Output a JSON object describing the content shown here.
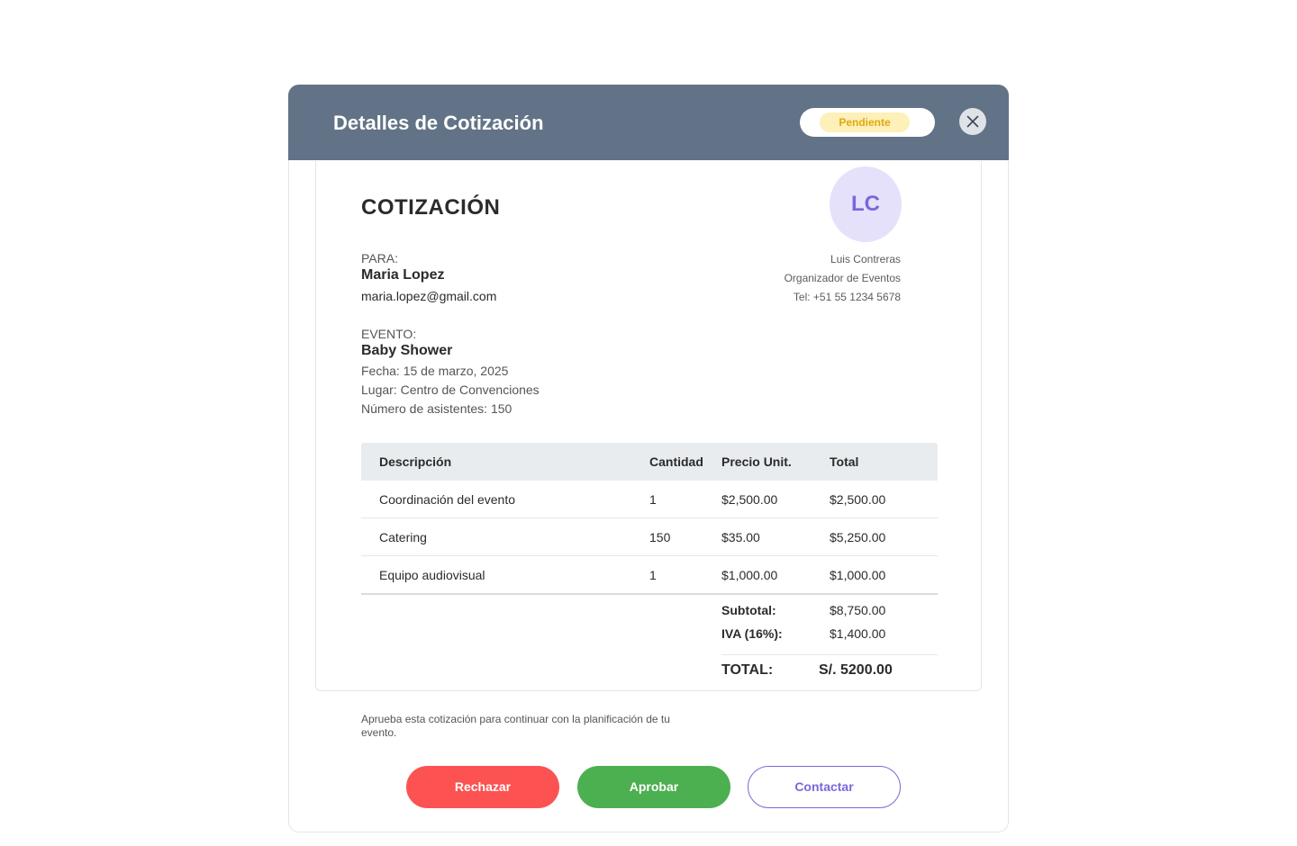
{
  "modal": {
    "title": "Detalles de Cotización",
    "status": "Pendiente",
    "close_icon": "close-icon"
  },
  "document": {
    "title": "COTIZACIÓN",
    "avatar_initials": "LC",
    "organizer": {
      "name": "Luis Contreras",
      "role": "Organizador de Eventos",
      "phone": "Tel: +51 55 1234 5678"
    },
    "client": {
      "label": "PARA:",
      "name": "Maria Lopez",
      "email": "maria.lopez@gmail.com"
    },
    "event": {
      "label": "EVENTO:",
      "name": "Baby Shower",
      "date": "Fecha: 15 de marzo, 2025",
      "place": "Lugar: Centro de Convenciones",
      "attendees": "Número de asistentes: 150"
    },
    "table": {
      "headers": [
        "Descripción",
        "Cantidad",
        "Precio Unit.",
        "Total"
      ],
      "rows": [
        [
          "Coordinación del evento",
          "1",
          "$2,500.00",
          "$2,500.00"
        ],
        [
          "Catering",
          "150",
          "$35.00",
          "$5,250.00"
        ],
        [
          "Equipo audiovisual",
          "1",
          "$1,000.00",
          "$1,000.00"
        ]
      ]
    },
    "summary": {
      "subtotal_label": "Subtotal:",
      "subtotal_value": "$8,750.00",
      "tax_label": "IVA (16%):",
      "tax_value": "$1,400.00",
      "total_label": "TOTAL:",
      "total_value": "S/. 5200.00"
    }
  },
  "note": "Aprueba esta cotización para continuar con la planificación de tu evento.",
  "actions": {
    "reject": "Rechazar",
    "approve": "Aprobar",
    "contact": "Contactar"
  },
  "colors": {
    "header": "#627387",
    "accent": "#7b66dc",
    "reject": "#fc5252",
    "approve": "#4caf50",
    "pending": "#e2a90b"
  }
}
